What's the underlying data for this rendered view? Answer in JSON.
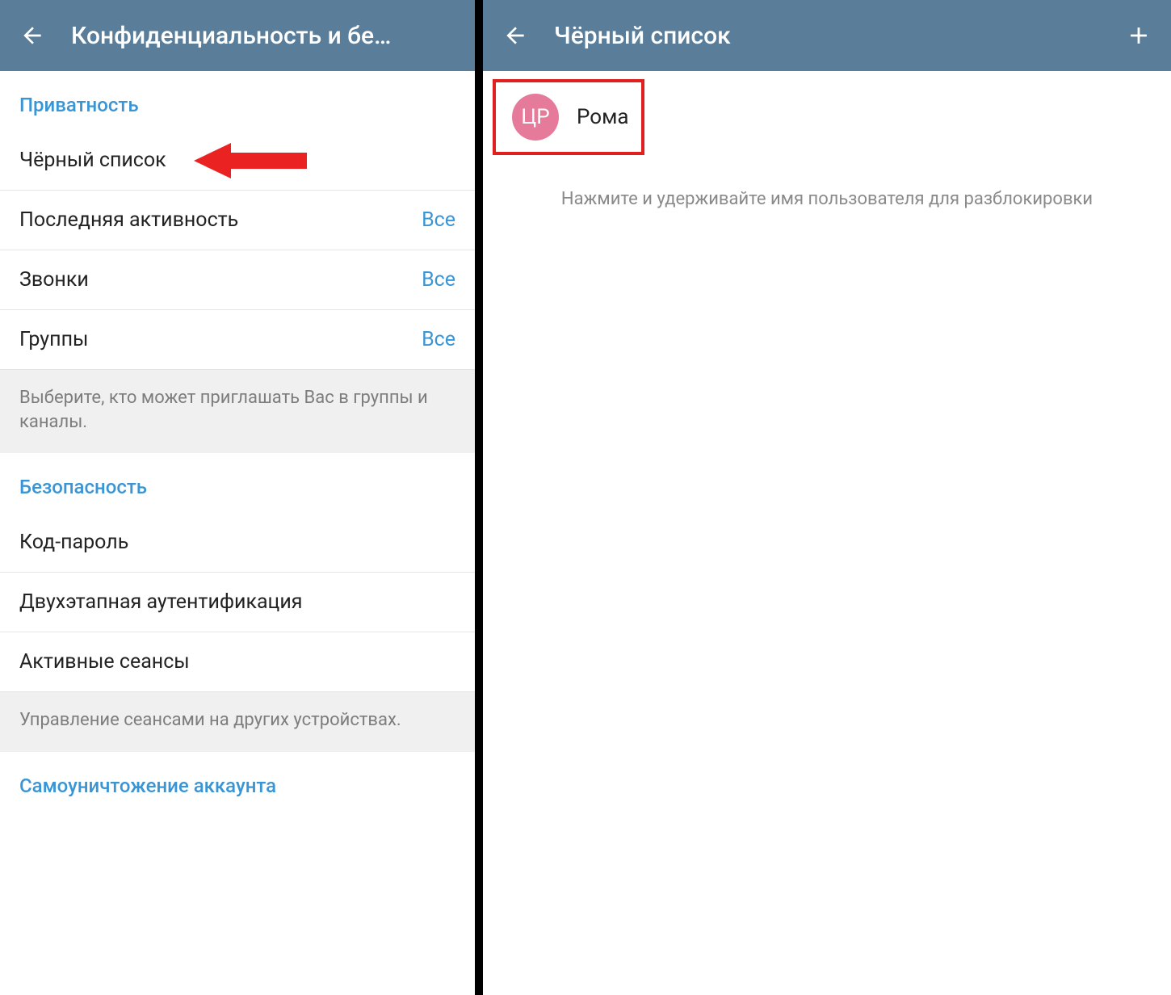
{
  "left": {
    "header_title": "Конфиденциальность и бе…",
    "privacy_section": "Приватность",
    "items_privacy": [
      {
        "label": "Чёрный список",
        "value": ""
      },
      {
        "label": "Последняя активность",
        "value": "Все"
      },
      {
        "label": "Звонки",
        "value": "Все"
      },
      {
        "label": "Группы",
        "value": "Все"
      }
    ],
    "privacy_hint": "Выберите, кто может приглашать Вас в группы и каналы.",
    "security_section": "Безопасность",
    "items_security": [
      {
        "label": "Код-пароль",
        "value": ""
      },
      {
        "label": "Двухэтапная аутентификация",
        "value": ""
      },
      {
        "label": "Активные сеансы",
        "value": ""
      }
    ],
    "security_hint": "Управление сеансами на других устройствах.",
    "self_destruct_section": "Самоуничтожение аккаунта"
  },
  "right": {
    "header_title": "Чёрный список",
    "blocked_user": {
      "initials": "ЦР",
      "name": "Рома",
      "avatar_color": "#e67a9a"
    },
    "hint": "Нажмите и удерживайте имя пользователя для разблокировки"
  }
}
